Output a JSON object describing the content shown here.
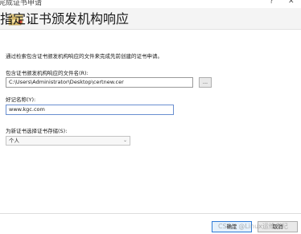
{
  "window": {
    "title": "完成证书申请",
    "help_glyph": "?",
    "close_glyph": "✕"
  },
  "header": {
    "title": "指定证书颁发机构响应"
  },
  "main": {
    "description": "通过检索包含证书颁发机构响应的文件来完成先前创建的证书申请。",
    "file_label": "包含证书颁发机构响应的文件名(R):",
    "file_value": "C:\\Users\\Administrator\\Desktop\\certnew.cer",
    "browse_label": "...",
    "friendly_label": "好记名称(Y):",
    "friendly_value": "www.kgc.com",
    "store_label": "为新证书选择证书存储(S):",
    "store_value": "个人"
  },
  "footer": {
    "ok_label": "确定",
    "cancel_label": "取消"
  },
  "watermark": "CSDN @Linux运维老纪"
}
